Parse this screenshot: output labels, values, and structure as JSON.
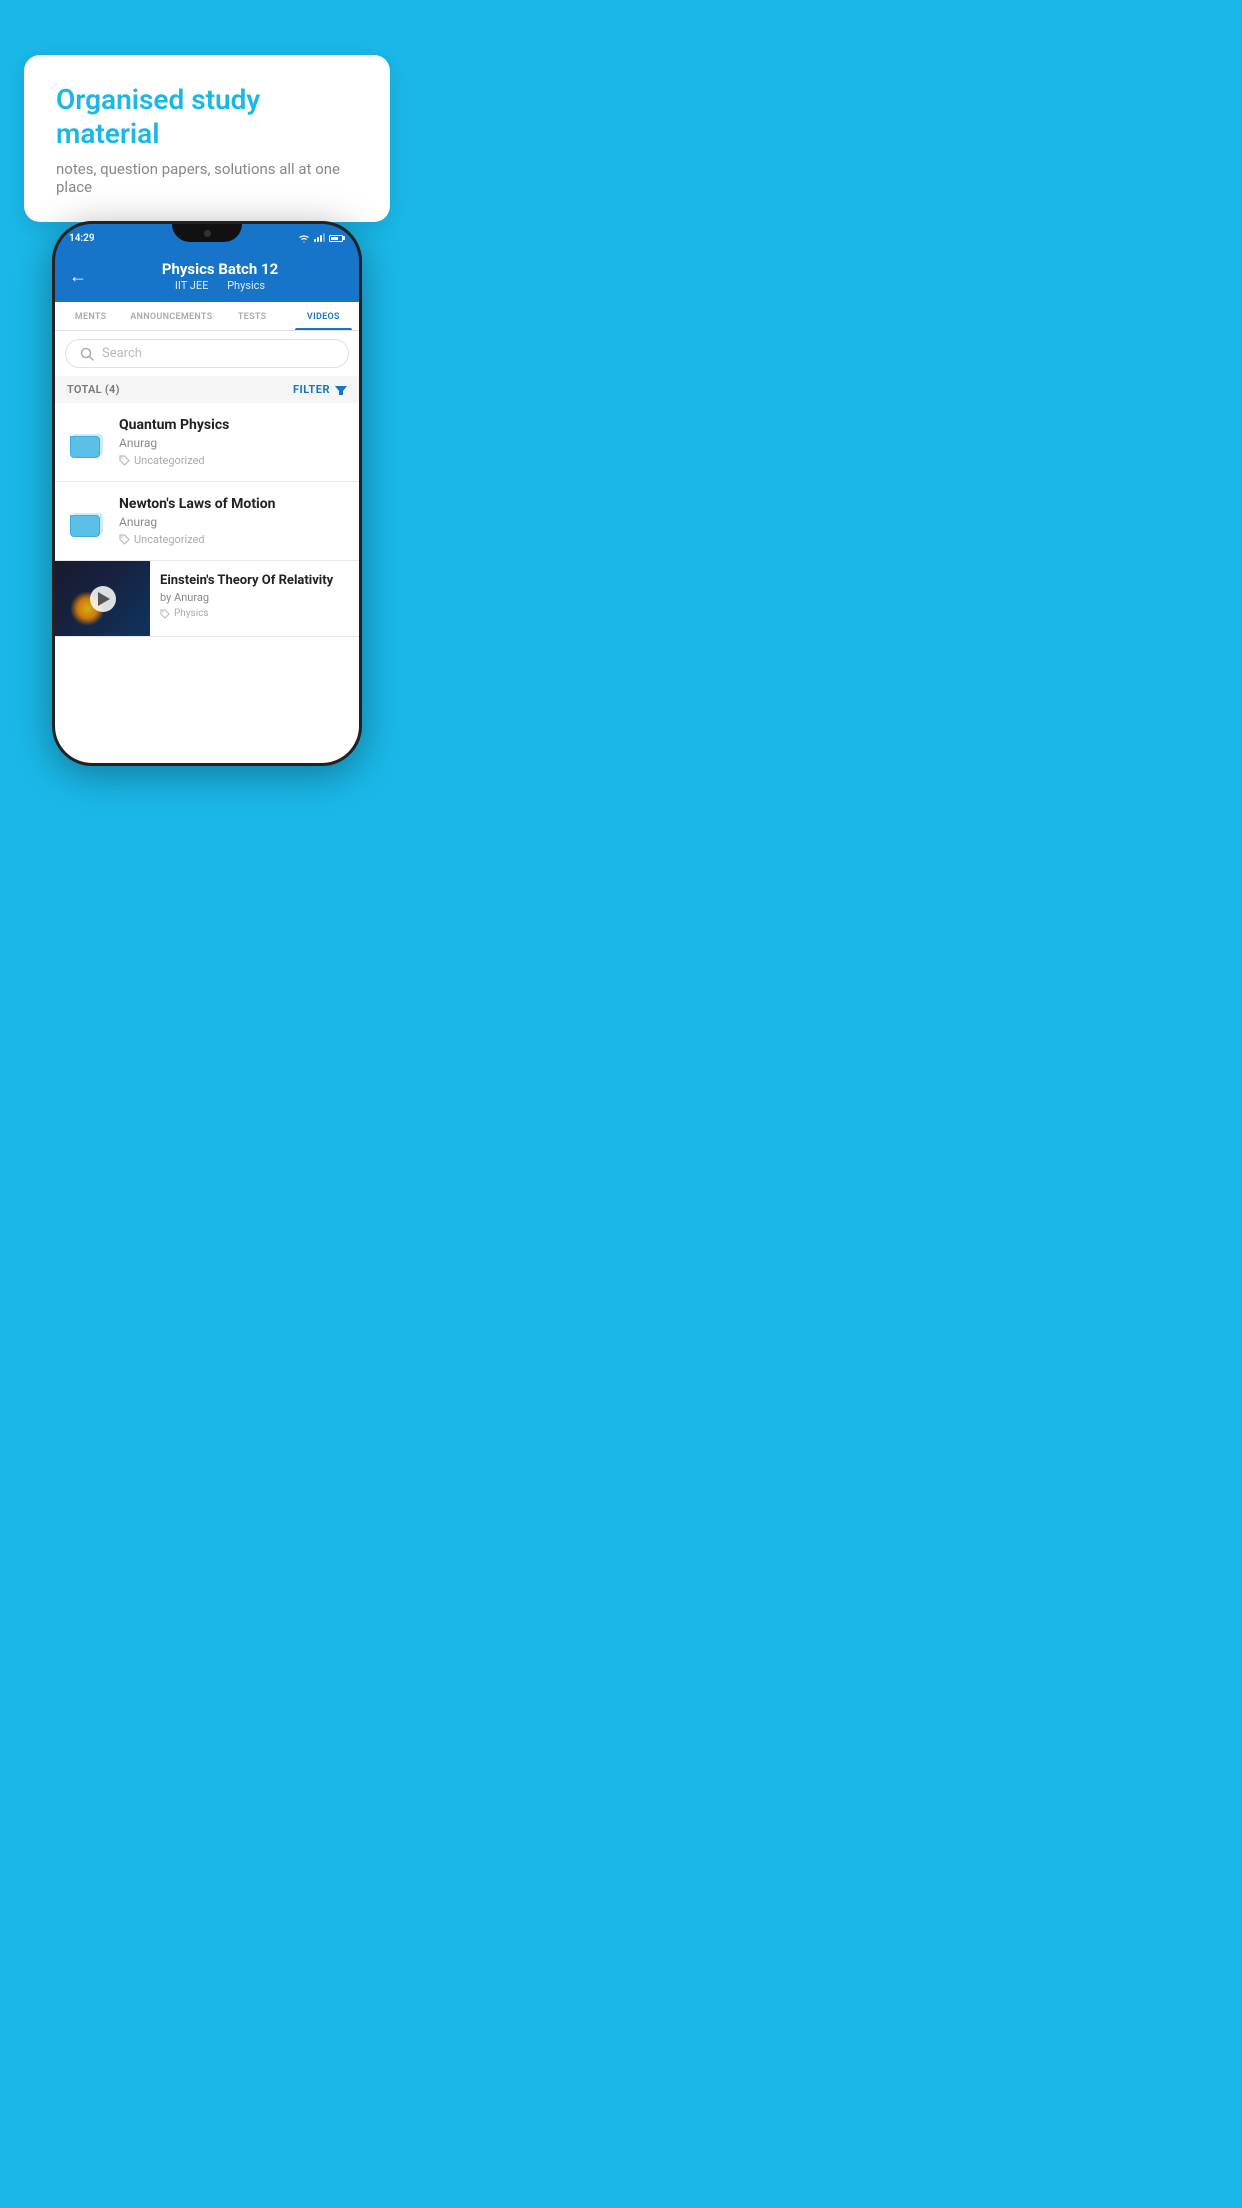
{
  "background_color": "#1ab8e8",
  "bubble": {
    "title": "Organised study material",
    "subtitle": "notes, question papers, solutions all at one place"
  },
  "phone": {
    "status_bar": {
      "time": "14:29"
    },
    "header": {
      "title": "Physics Batch 12",
      "subtitle_part1": "IIT JEE",
      "subtitle_part2": "Physics",
      "back_label": "←"
    },
    "tabs": [
      {
        "label": "MENTS",
        "active": false
      },
      {
        "label": "ANNOUNCEMENTS",
        "active": false
      },
      {
        "label": "TESTS",
        "active": false
      },
      {
        "label": "VIDEOS",
        "active": true
      }
    ],
    "search": {
      "placeholder": "Search"
    },
    "filter_bar": {
      "total_label": "TOTAL (4)",
      "filter_label": "FILTER"
    },
    "video_items": [
      {
        "id": 1,
        "title": "Quantum Physics",
        "author": "Anurag",
        "tag": "Uncategorized",
        "has_thumb": false
      },
      {
        "id": 2,
        "title": "Newton's Laws of Motion",
        "author": "Anurag",
        "tag": "Uncategorized",
        "has_thumb": false
      },
      {
        "id": 3,
        "title": "Einstein's Theory Of Relativity",
        "author": "by Anurag",
        "tag": "Physics",
        "has_thumb": true
      }
    ]
  }
}
